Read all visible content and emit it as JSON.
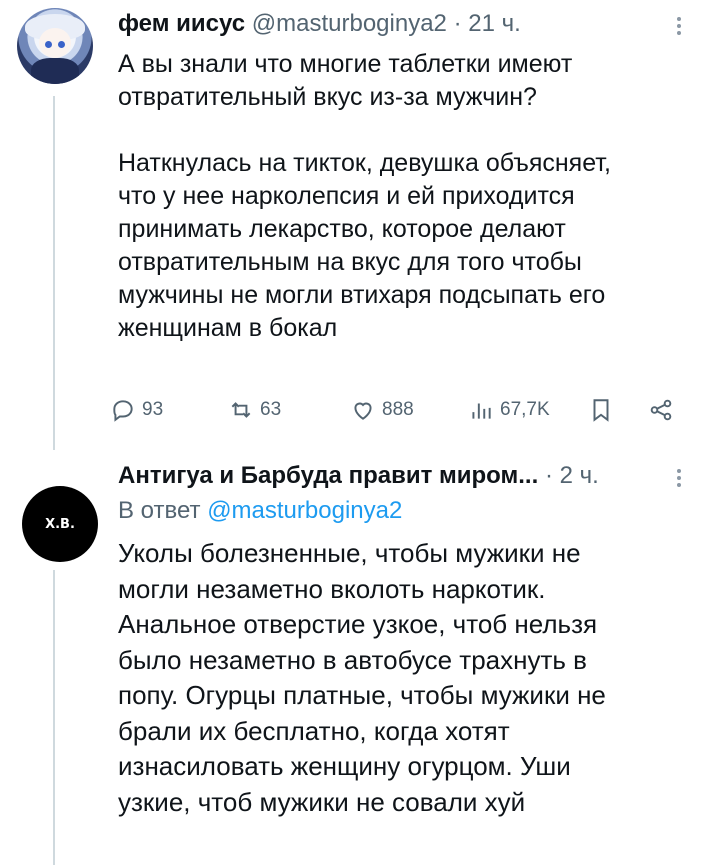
{
  "tweet1": {
    "author_name": "фем иисус",
    "handle": "@masturboginya2",
    "separator": "·",
    "time": "21 ч.",
    "text": "А вы знали что многие таблетки имеют\nотвратительный вкус из-за мужчин?\n\nНаткнулась на тикток, девушка объясняет,\nчто у нее нарколепсия и ей приходится\nпринимать лекарство, которое делают\nотвратительным на вкус для того чтобы\nмужчины не могли втихаря подсыпать его\nженщинам в бокал",
    "actions": {
      "replies": "93",
      "retweets": "63",
      "likes": "888",
      "views": "67,7K"
    },
    "icons": [
      "reply-icon",
      "retweet-icon",
      "like-icon",
      "views-icon",
      "bookmark-icon",
      "share-icon"
    ]
  },
  "tweet2": {
    "avatar_text": "Х.В.",
    "author_name": "Антигуа и Барбуда правит миром...",
    "separator": "·",
    "time": "2 ч.",
    "reply_prefix": "В ответ",
    "reply_mention": "@masturboginya2",
    "text": "Уколы болезненные, чтобы мужики не\nмогли незаметно вколоть наркотик.\nАнальное отверстие узкое, чтоб нельзя\nбыло незаметно в автобусе трахнуть в\nпопу. Огурцы платные, чтобы мужики не\nбрали их бесплатно, когда хотят\nизнасиловать женщину огурцом. Уши\nузкие, чтоб мужики не совали хуй"
  },
  "colors": {
    "text": "#0f1419",
    "secondary": "#536471",
    "link": "#1d9bf0",
    "thread_line": "#cfd9de"
  }
}
